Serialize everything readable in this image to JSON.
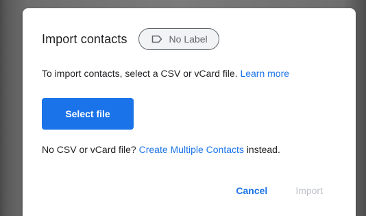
{
  "dialog": {
    "title": "Import contacts",
    "label_chip": {
      "icon": "label-outline-icon",
      "text": "No Label"
    },
    "description": {
      "text": "To import contacts, select a CSV or vCard file.",
      "link": "Learn more"
    },
    "select_file_label": "Select file",
    "no_file": {
      "prefix": "No CSV or vCard file?",
      "link": "Create Multiple Contacts",
      "suffix": "instead."
    },
    "actions": {
      "cancel": "Cancel",
      "import": "Import"
    }
  },
  "colors": {
    "accent": "#1a73e8",
    "text": "#202124",
    "muted": "#5f6368",
    "disabled": "#bdc1c6"
  }
}
